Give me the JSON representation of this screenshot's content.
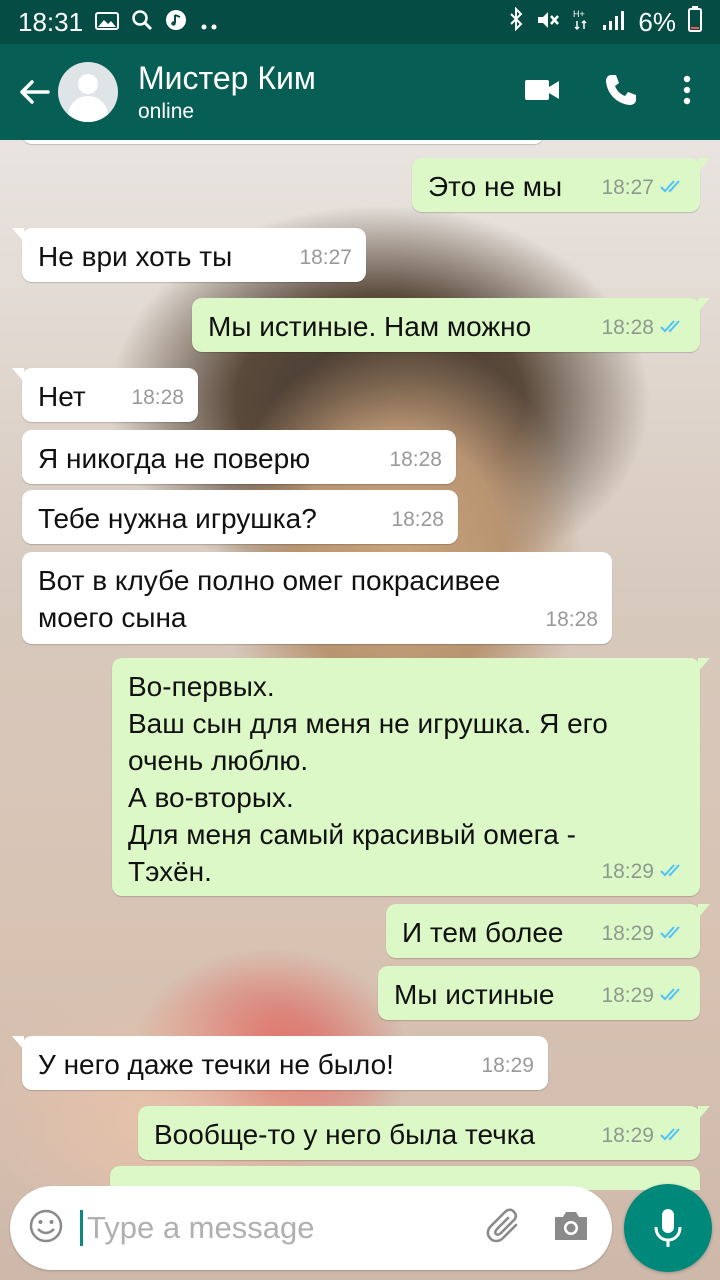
{
  "status_bar": {
    "time": "18:31",
    "battery": "6%"
  },
  "header": {
    "contact_name": "Мистер Ким",
    "contact_status": "online"
  },
  "messages": [
    {
      "dir": "out",
      "text": "Это не мы",
      "time": "18:27",
      "ticks": true
    },
    {
      "dir": "in",
      "text": "Не ври хоть ты",
      "time": "18:27"
    },
    {
      "dir": "out",
      "text": "Мы истиные. Нам можно",
      "time": "18:28",
      "ticks": true
    },
    {
      "dir": "in",
      "text": "Нет",
      "time": "18:28"
    },
    {
      "dir": "in",
      "text": "Я никогда не поверю",
      "time": "18:28"
    },
    {
      "dir": "in",
      "text": "Тебе нужна игрушка?",
      "time": "18:28"
    },
    {
      "dir": "in",
      "text": "Вот в клубе полно омег покрасивее\nмоего сына",
      "time": "18:28"
    },
    {
      "dir": "out",
      "text": "Во-первых.\nВаш сын для меня не игрушка. Я его\nочень люблю.\nА во-вторых.\nДля меня самый красивый омега -\nТэхён.",
      "time": "18:29",
      "ticks": true
    },
    {
      "dir": "out",
      "text": "И тем более",
      "time": "18:29",
      "ticks": true
    },
    {
      "dir": "out",
      "text": "Мы истиные",
      "time": "18:29",
      "ticks": true
    },
    {
      "dir": "in",
      "text": "У него даже течки не было!",
      "time": "18:29"
    },
    {
      "dir": "out",
      "text": "Вообще-то у него была течка",
      "time": "18:29",
      "ticks": true
    }
  ],
  "composer": {
    "placeholder": "Type a message"
  },
  "colors": {
    "header": "#075e54",
    "status_bar": "#054d44",
    "outgoing_bubble": "#dcf8c6",
    "incoming_bubble": "#ffffff",
    "read_ticks": "#4fc3f7",
    "mic_button": "#00897b"
  }
}
